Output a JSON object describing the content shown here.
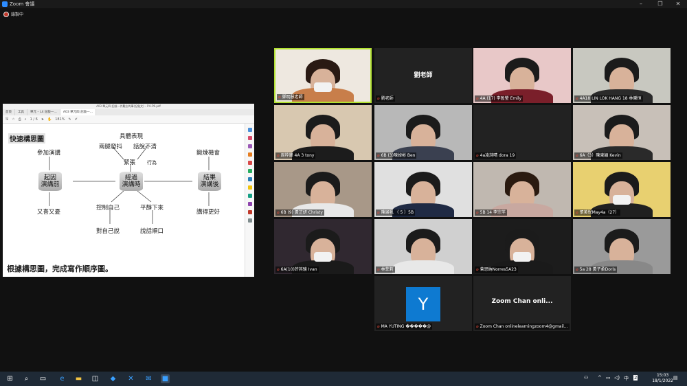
{
  "window": {
    "title": "Zoom 會議",
    "recording_label": "錄製中"
  },
  "share": {
    "window_title": "A03 單元四 記敍一件難忘的事(記敍文) – P4–P6.pdf",
    "tabs": [
      "首頁",
      "工具",
      "單元 – L4 記敍一…",
      "A03 單元四 記敍一…"
    ],
    "toolbar_zoom": "181%",
    "toolbar_page": "1 / 6",
    "header": "快速構思圖",
    "nodes": {
      "cause_cyl": "起因\n演講前",
      "process_cyl": "經過\n演講時",
      "result_cyl": "結果\n演講後",
      "cause_top": "參加演講",
      "cause_bottom": "又喜又憂",
      "concrete": "具體表現",
      "legs": "兩腿發抖",
      "speech": "話說不清",
      "nervous": "緊張",
      "action": "行為",
      "control": "控制自己",
      "calm": "平靜下來",
      "tell_self": "對自己說",
      "fluent": "說話順口",
      "practice": "鍛煉機會",
      "better": "講得更好"
    },
    "footer": "根據構思圖，完成寫作順序圖。"
  },
  "gallery": [
    {
      "name": "鄧明慧老師",
      "type": "video",
      "shirt": "#c87e4a",
      "mask": true,
      "hair": "#2a1a14",
      "active": true,
      "bg": "#eee8e0"
    },
    {
      "name": "劉老師",
      "type": "name",
      "big": "劉老師"
    },
    {
      "name": "4A (17) 李盈瑩 Emily",
      "type": "video",
      "shirt": "#7a1f2a",
      "bg": "#e8c8c8",
      "hair": "#1b1b1b"
    },
    {
      "name": "4A18 LIN LOK HANG 18 林樂恒",
      "type": "video",
      "shirt": "#2a2a2a",
      "bg": "#c8c8c0",
      "hair": "#1b1b1b"
    },
    {
      "name": "周梓鋒 4A 3 tony",
      "type": "video",
      "shirt": "#1c1c1c",
      "bg": "#d8c8b0",
      "hair": "#1b1b1b"
    },
    {
      "name": "6B (3)陳焯彬 Ben",
      "type": "video",
      "shirt": "#3a4050",
      "bg": "#b8b8b8",
      "hair": "#1b1b1b"
    },
    {
      "name": "4a凌詩晴 dora 19",
      "type": "blank"
    },
    {
      "name": "6A（3）陳東穎 Kevin",
      "type": "video",
      "shirt": "#2a2a2a",
      "bg": "#c8c0b8",
      "hair": "#1b1b1b"
    },
    {
      "name": "6B (9) 黃芷妍 Christy",
      "type": "video",
      "shirt": "#e8e8e8",
      "bg": "#a89888",
      "hair": "#1b1b1b"
    },
    {
      "name": "陳展帆 （ 5 ）5B",
      "type": "video",
      "shirt": "#1f2a44",
      "bg": "#e0e0e0",
      "hair": "#1b1b1b"
    },
    {
      "name": "5B 14 李宗芊",
      "type": "video",
      "shirt": "#c8a8a0",
      "bg": "#c0b8b0",
      "hair": "#2a1a10"
    },
    {
      "name": "張美悅May4a（27）",
      "type": "video",
      "shirt": "#202020",
      "mask": true,
      "bg": "#e8d070",
      "hair": "#1b1b1b"
    },
    {
      "name": "6A(10)許其駿 Ivan",
      "type": "video",
      "shirt": "#1a1a1a",
      "mask": true,
      "bg": "#302830",
      "hair": "#1b1b1b"
    },
    {
      "name": "林菲莉",
      "type": "video",
      "shirt": "#e8e8e8",
      "bg": "#d0d0d0",
      "hair": "#1b1b1b"
    },
    {
      "name": "曾思納Norres5A23",
      "type": "video",
      "shirt": "#1a1a1a",
      "mask": true,
      "bg": "#1c1c1c",
      "hair": "#1b1b1b"
    },
    {
      "name": "5a 28 黃子柔Doris",
      "type": "video",
      "shirt": "#888888",
      "bg": "#9a9a9a",
      "hair": "#1b1b1b"
    },
    {
      "name": "MA YUTING �����@",
      "type": "avatar",
      "letter": "Y"
    },
    {
      "name": "Zoom Chan onlinelearningzoom4@gmail...",
      "type": "name",
      "big": "Zoom Chan onli..."
    }
  ],
  "taskbar": {
    "time": "15:03",
    "date": "18/1/2022",
    "lang": "中",
    "notif": "2"
  }
}
